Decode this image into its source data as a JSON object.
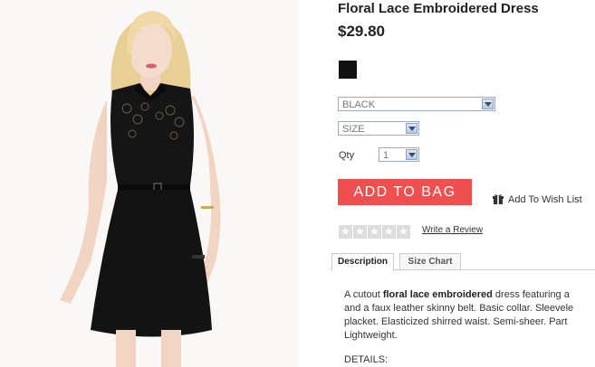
{
  "product": {
    "title": "Floral Lace Embroidered Dress",
    "price": "$29.80",
    "swatch_color": "#111111"
  },
  "options": {
    "color_select": "BLACK",
    "size_select": "SIZE",
    "qty_label": "Qty",
    "qty_value": "1"
  },
  "actions": {
    "add_to_bag": "ADD TO BAG",
    "wishlist": "Add To Wish List",
    "write_review": "Write a Review"
  },
  "rating": {
    "stars_filled": 0,
    "stars_total": 5
  },
  "tabs": [
    {
      "label": "Description"
    },
    {
      "label": "Size Chart"
    }
  ],
  "description": {
    "line1_pre": "A cutout ",
    "line1_bold": "floral lace embroidered",
    "line1_post": " dress featuring a",
    "line2": "and a faux leather skinny belt. Basic collar. Sleevele",
    "line3": "placket. Elasticized shirred waist. Semi-sheer. Part",
    "line4": "Lightweight.",
    "details": "DETAILS:"
  },
  "colors": {
    "accent": "#ef4f4f",
    "select_border": "#9aa9c4"
  }
}
